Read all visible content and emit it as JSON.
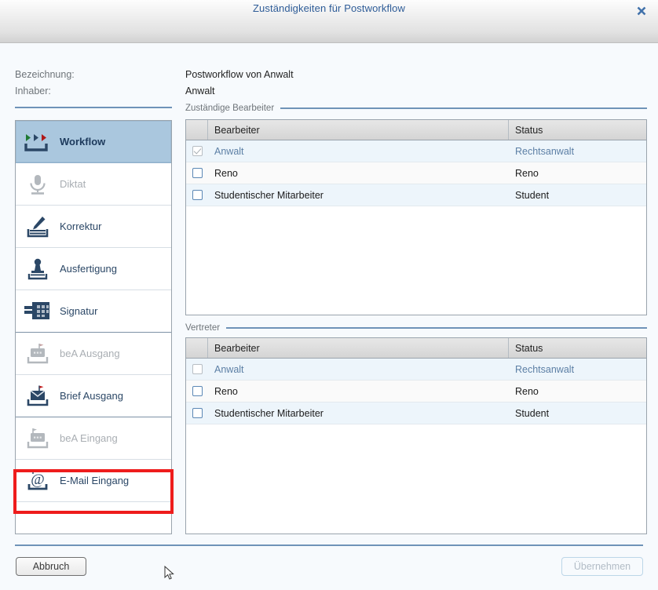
{
  "window": {
    "title": "Zuständigkeiten für Postworkflow",
    "close_icon": "close-x-icon"
  },
  "meta": {
    "labels": [
      "Bezeichnung:",
      "Inhaber:"
    ],
    "values": [
      "Postworkflow von Anwalt",
      "Anwalt"
    ]
  },
  "sidebar": {
    "items": [
      {
        "label": "Workflow",
        "icon": "workflow-arrows-icon",
        "state": "active"
      },
      {
        "label": "Diktat",
        "icon": "microphone-icon",
        "state": "disabled"
      },
      {
        "label": "Korrektur",
        "icon": "pencil-tray-icon",
        "state": "normal"
      },
      {
        "label": "Ausfertigung",
        "icon": "stamp-icon",
        "state": "normal"
      },
      {
        "label": "Signatur",
        "icon": "signature-card-icon",
        "state": "normal"
      },
      {
        "label": "beA Ausgang",
        "icon": "bea-outbox-icon",
        "state": "disabled"
      },
      {
        "label": "Brief Ausgang",
        "icon": "letter-outbox-icon",
        "state": "normal"
      },
      {
        "label": "beA Eingang",
        "icon": "bea-inbox-icon",
        "state": "disabled"
      },
      {
        "label": "E-Mail Eingang",
        "icon": "email-at-inbox-icon",
        "state": "normal"
      }
    ],
    "highlight_index": 8,
    "highlight_color": "#ee1c1c"
  },
  "sections": [
    {
      "caption": "Zuständige Bearbeiter",
      "columns": [
        "",
        "Bearbeiter",
        "Status"
      ],
      "rows": [
        {
          "checked": true,
          "dim": true,
          "name": "Anwalt",
          "status": "Rechtsanwalt",
          "muted": true
        },
        {
          "checked": false,
          "dim": false,
          "name": "Reno",
          "status": "Reno",
          "muted": false
        },
        {
          "checked": false,
          "dim": false,
          "name": "Studentischer Mitarbeiter",
          "status": "Student",
          "muted": false
        }
      ]
    },
    {
      "caption": "Vertreter",
      "columns": [
        "",
        "Bearbeiter",
        "Status"
      ],
      "rows": [
        {
          "checked": false,
          "dim": true,
          "name": "Anwalt",
          "status": "Rechtsanwalt",
          "muted": true
        },
        {
          "checked": false,
          "dim": false,
          "name": "Reno",
          "status": "Reno",
          "muted": false
        },
        {
          "checked": false,
          "dim": false,
          "name": "Studentischer Mitarbeiter",
          "status": "Student",
          "muted": false
        }
      ]
    }
  ],
  "footer": {
    "cancel_label": "Abbruch",
    "apply_label": "Übernehmen",
    "apply_enabled": false
  },
  "colors": {
    "accent_rule": "#6f93b8",
    "selected_row": "#edf5fb",
    "active_item": "#aac7de",
    "title_text": "#2e5c97"
  }
}
